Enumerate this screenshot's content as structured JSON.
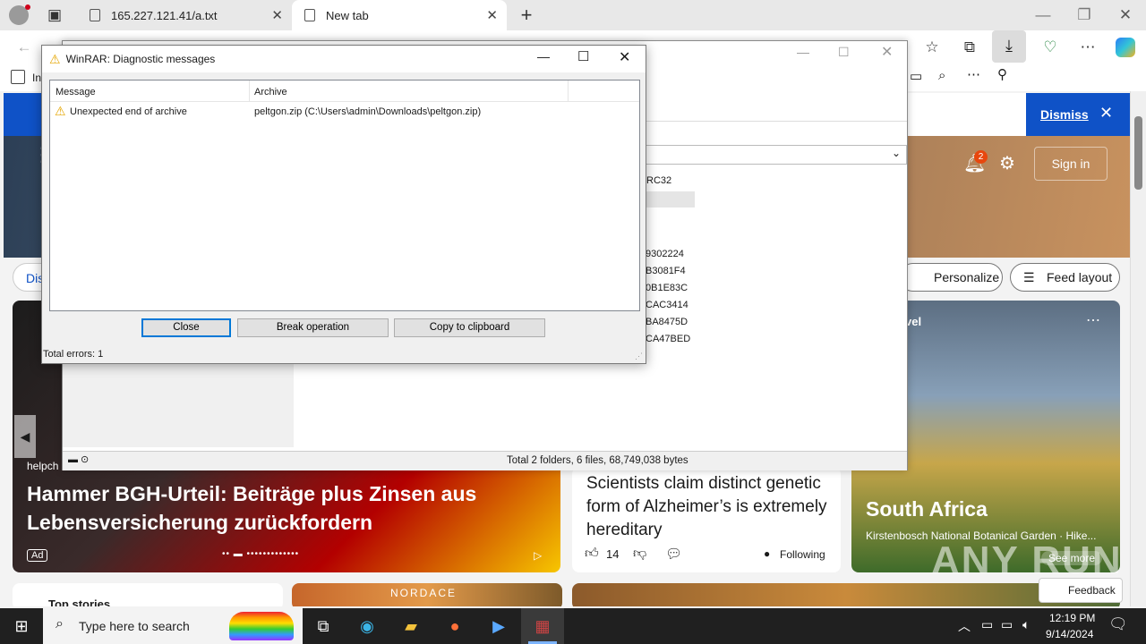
{
  "browser": {
    "tabs": [
      {
        "title": "165.227.121.41/a.txt"
      },
      {
        "title": "New tab"
      }
    ],
    "bookmark_prefix": "In"
  },
  "msn": {
    "dismiss": "Dismiss",
    "notif_count": "2",
    "sign_in": "Sign in",
    "disc_partial": "Dis",
    "personalize": "Personalize",
    "feed_layout": "Feed layout",
    "news1": {
      "source_partial": "helpch",
      "title": "Hammer BGH-Urteil: Beiträge plus Zinsen aus Lebensversicherung zurückfordern",
      "ad": "Ad"
    },
    "news2": {
      "title": "Scientists claim distinct genetic form of Alzheimer’s is extremely hereditary",
      "likes": "14",
      "following": "Following"
    },
    "news3": {
      "category_partial": "vel",
      "title": "South Africa",
      "subtitle": "Kirstenbosch National Botanical Garden · Hike...",
      "see_more": "See more"
    },
    "top_stories": "Top stories",
    "nordace": "NORDACE",
    "feedback": "Feedback",
    "watermark": "ANY RUN"
  },
  "winrar_main": {
    "crc_header": "RC32",
    "crc_values": [
      "9302224",
      "B3081F4",
      "0B1E83C",
      "CAC3414",
      "BA8475D",
      "CA47BED"
    ],
    "status": "Total 2 folders, 6 files, 68,749,038 bytes"
  },
  "dialog": {
    "title": "WinRAR: Diagnostic messages",
    "columns": {
      "message": "Message",
      "archive": "Archive"
    },
    "rows": [
      {
        "message": "Unexpected end of archive",
        "archive": "peltgon.zip (C:\\Users\\admin\\Downloads\\peltgon.zip)"
      }
    ],
    "buttons": {
      "close": "Close",
      "break": "Break operation",
      "copy": "Copy to clipboard"
    },
    "total": "Total errors: 1"
  },
  "taskbar": {
    "search_placeholder": "Type here to search",
    "time": "12:19 PM",
    "date": "9/14/2024"
  },
  "colors": {
    "msn_blue": "#0f52c7",
    "taskbar": "#202020",
    "focus_btn": "#0078d7",
    "badge": "#e8470e"
  }
}
